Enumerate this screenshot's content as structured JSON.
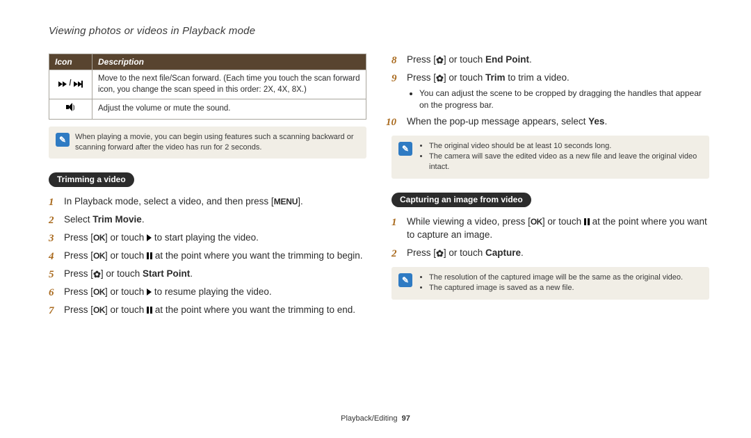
{
  "page": {
    "title": "Viewing photos or videos in Playback mode",
    "footer_section": "Playback/Editing",
    "footer_page": "97"
  },
  "icon_table": {
    "headers": {
      "icon": "Icon",
      "desc": "Description"
    },
    "rows": [
      {
        "icon": "ff-skip",
        "desc": "Move to the next file/Scan forward. (Each time you touch the scan forward icon, you change the scan speed in this order: 2X, 4X, 8X.)"
      },
      {
        "icon": "speaker",
        "desc": "Adjust the volume or mute the sound."
      }
    ]
  },
  "note_scan": "When playing a movie, you can begin using features such a scanning backward or scanning forward after the video has run for 2 seconds.",
  "trim": {
    "heading": "Trimming a video",
    "steps": {
      "s1a": "In Playback mode, select a video, and then press [",
      "s1b": "].",
      "s2a": "Select ",
      "s2b": "Trim Movie",
      "s2c": ".",
      "s3a": "Press [",
      "s3b": "] or touch ",
      "s3c": " to start playing the video.",
      "s4a": "Press [",
      "s4b": "] or touch ",
      "s4c": " at the point where you want the trimming to begin.",
      "s5a": "Press [",
      "s5b": "] or touch ",
      "s5c": "Start Point",
      "s5d": ".",
      "s6a": "Press [",
      "s6b": "] or touch ",
      "s6c": " to resume playing the video.",
      "s7a": "Press [",
      "s7b": "] or touch ",
      "s7c": " at the point where you want the trimming to end.",
      "s8a": "Press [",
      "s8b": "] or touch ",
      "s8c": "End Point",
      "s8d": ".",
      "s9a": "Press [",
      "s9b": "] or touch ",
      "s9c": "Trim",
      "s9d": " to trim a video.",
      "s9_sub1": "You can adjust the scene to be cropped by dragging the handles that appear on the progress bar.",
      "s10a": "When the pop-up message appears, select ",
      "s10b": "Yes",
      "s10c": "."
    },
    "note": {
      "b1": "The original video should be at least 10 seconds long.",
      "b2": "The camera will save the edited video as a new file and leave the original video intact."
    }
  },
  "capture": {
    "heading": "Capturing an image from video",
    "steps": {
      "s1a": "While viewing a video, press [",
      "s1b": "] or touch ",
      "s1c": " at the point where you want to capture an image.",
      "s2a": "Press [",
      "s2b": "] or touch ",
      "s2c": "Capture",
      "s2d": "."
    },
    "note": {
      "b1": "The resolution of the captured image will be the same as the original video.",
      "b2": "The captured image is saved as a new file."
    }
  },
  "glyphs": {
    "ok": "OK",
    "menu": "MENU",
    "flower": "✿"
  }
}
